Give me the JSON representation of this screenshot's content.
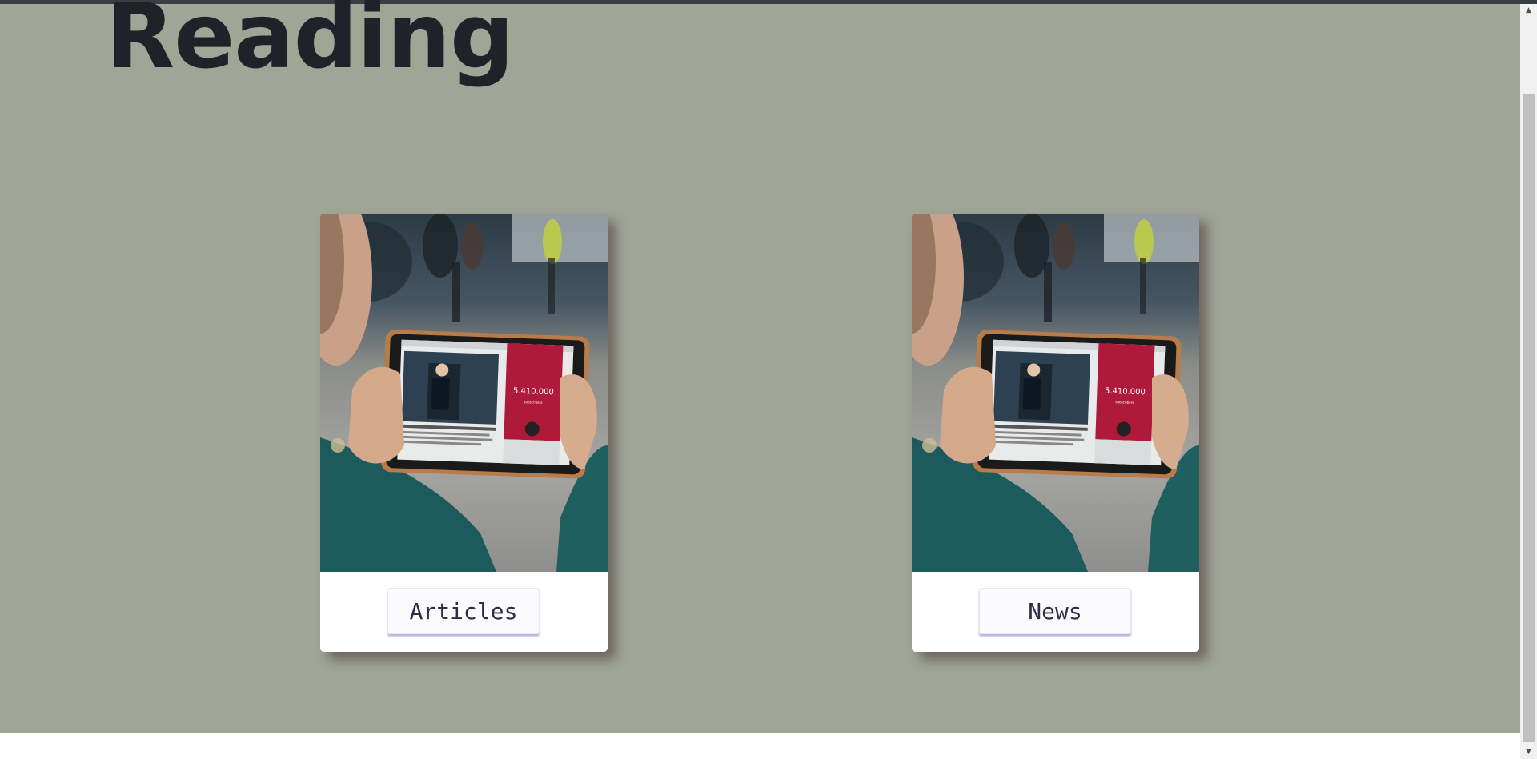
{
  "header": {
    "title": "Reading"
  },
  "cards": [
    {
      "image_icon": "tablet-news-photo",
      "button_label": "Articles"
    },
    {
      "image_icon": "tablet-news-photo",
      "button_label": "News"
    }
  ],
  "photo": {
    "screen_number": "5.410.000",
    "screen_caption": "subscribers"
  },
  "colors": {
    "page_background": "#a0a596",
    "title_color": "#1f2329",
    "card_background": "#ffffff",
    "button_text": "#2d2d45",
    "button_shadow": "#6e5abe"
  }
}
